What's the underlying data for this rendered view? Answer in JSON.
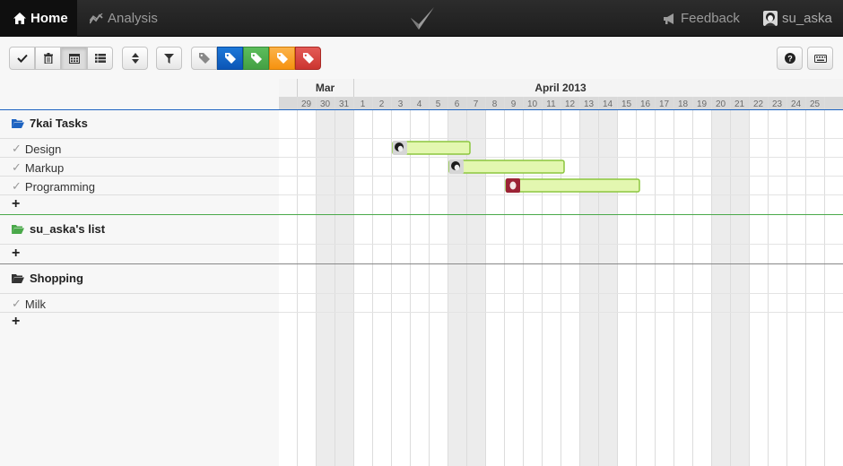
{
  "nav": {
    "home_label": "Home",
    "analysis_label": "Analysis",
    "feedback_label": "Feedback",
    "user_label": "su_aska"
  },
  "toolbar": {
    "buttons": [
      "check-icon",
      "trash-icon",
      "calendar-icon",
      "list-icon",
      "sort-icon",
      "filter-icon",
      "keyboard-icon",
      "help-icon"
    ],
    "tag_colors": [
      "#888888",
      "#0b5fc6",
      "#4cae4c",
      "#f7961b",
      "#d63a35"
    ]
  },
  "timeline": {
    "months": [
      {
        "label": "Mar",
        "days": [
          "29",
          "30",
          "31"
        ]
      },
      {
        "label": "April 2013",
        "days": [
          "1",
          "2",
          "3",
          "4",
          "5",
          "6",
          "7",
          "8",
          "9",
          "10",
          "11",
          "12",
          "13",
          "14",
          "15",
          "16",
          "17",
          "18",
          "19",
          "20",
          "21",
          "22",
          "23",
          "24",
          "25"
        ]
      }
    ],
    "weekend_days": [
      "30",
      "31",
      "6",
      "7",
      "13",
      "14",
      "20",
      "21"
    ]
  },
  "groups": [
    {
      "name": "7kai Tasks",
      "folder_color": "#1d63c1",
      "tasks": [
        {
          "name": "Design",
          "start": "3",
          "end": "7",
          "avatar": "dark"
        },
        {
          "name": "Markup",
          "start": "6",
          "end": "12",
          "avatar": "dark"
        },
        {
          "name": "Programming",
          "start": "9",
          "end": "16",
          "avatar": "red"
        }
      ]
    },
    {
      "name": "su_aska's list",
      "folder_color": "#4aa94a",
      "tasks": []
    },
    {
      "name": "Shopping",
      "folder_color": "#333333",
      "tasks": [
        {
          "name": "Milk"
        }
      ]
    }
  ],
  "add_label": "+"
}
